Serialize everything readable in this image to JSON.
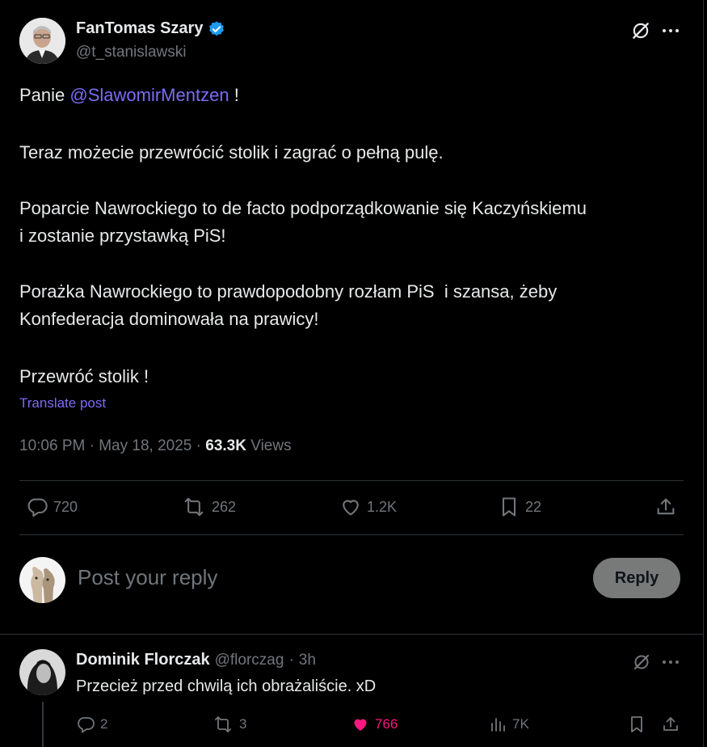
{
  "post": {
    "author_name": "FanTomas Szary",
    "author_handle": "@t_stanislawski",
    "text_intro": "Panie ",
    "mention": "@SlawomirMentzen",
    "text_intro_end": " !",
    "line2": "Teraz możecie przewrócić stolik i zagrać o pełną pulę.",
    "line3a": "Poparcie Nawrockiego to de facto podporządkowanie się Kaczyńskiemu",
    "line3b": "i zostanie przystawką PiS!",
    "line4a": "Porażka Nawrockiego to prawdopodobny rozłam PiS  i szansa, żeby",
    "line4b": "Konfederacja dominowała na prawicy!",
    "line5": "Przewróć stolik !",
    "translate_label": "Translate post",
    "time": "10:06 PM",
    "date_sep": " · ",
    "date": "May 18, 2025",
    "views_count": "63.3K",
    "views_label": "Views",
    "actions": {
      "replies": "720",
      "reposts": "262",
      "likes": "1.2K",
      "bookmarks": "22"
    }
  },
  "composer": {
    "placeholder": "Post your reply",
    "reply_button": "Reply"
  },
  "reply": {
    "author_name": "Dominik Florczak",
    "author_handle": "@florczag",
    "time": "3h",
    "text": "Przecież przed chwilą ich obrażaliście. xD",
    "actions": {
      "replies": "2",
      "reposts": "3",
      "likes": "766",
      "views": "7K"
    },
    "like_color": "#f91880"
  },
  "colors": {
    "accent": "#7b6cf6",
    "verified": "#1d9bf0",
    "background": "#000000",
    "divider": "#2f3336"
  }
}
